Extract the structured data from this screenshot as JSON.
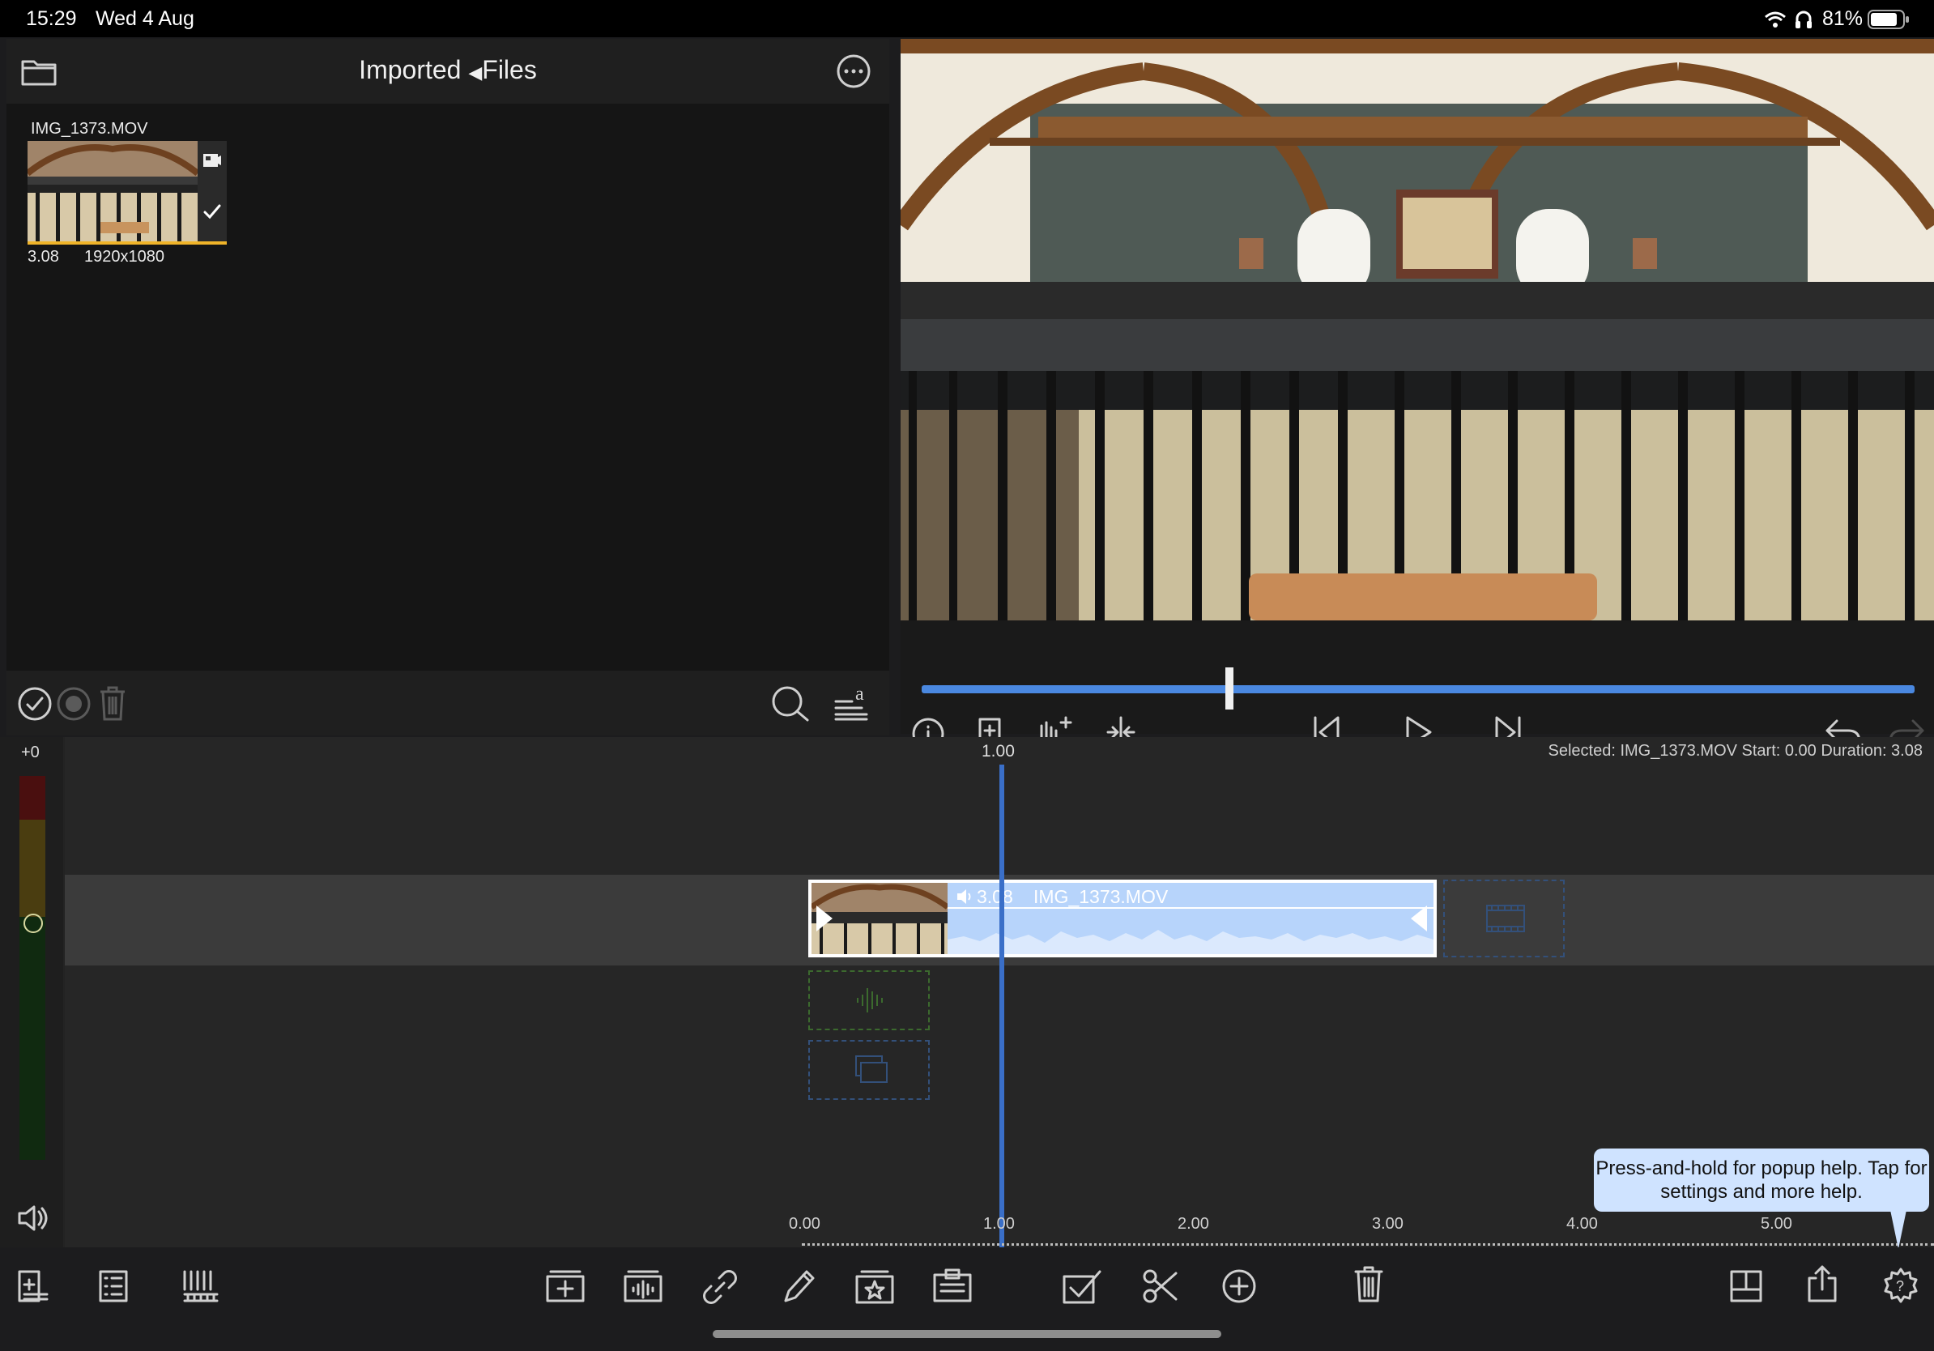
{
  "status_bar": {
    "time": "15:29",
    "date": "Wed 4 Aug",
    "battery": "81%",
    "icons": [
      "wifi-icon",
      "headphones-icon",
      "battery-icon"
    ]
  },
  "browser": {
    "title": "Imported",
    "back_label": "Files",
    "clip": {
      "name": "IMG_1373.MOV",
      "duration": "3.08",
      "resolution": "1920x1080"
    }
  },
  "viewer": {
    "scrub_position": 0.31
  },
  "timeline": {
    "meter_label": "+0",
    "playhead_label": "1.00",
    "selection_info": "Selected: IMG_1373.MOV Start: 0.00 Duration: 3.08",
    "clip": {
      "duration": "3.08",
      "name": "IMG_1373.MOV"
    },
    "ruler": [
      "0.00",
      "1.00",
      "2.00",
      "3.00",
      "4.00",
      "5.00"
    ],
    "tooltip": "Press-and-hold for popup help. Tap for settings and more help."
  },
  "colors": {
    "accent": "#3a7bd5",
    "clip_audio": "#b7d4fb",
    "selection_border": "#ffffff",
    "tooltip_bg": "#cfe3ff",
    "thumb_highlight": "#f0b429"
  }
}
